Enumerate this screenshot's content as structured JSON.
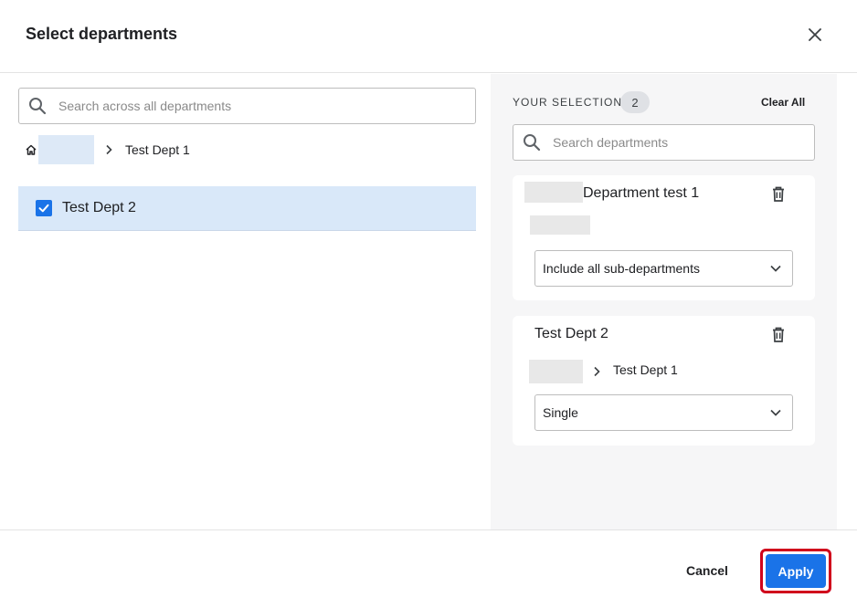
{
  "dialog": {
    "title": "Select departments"
  },
  "left": {
    "search_placeholder": "Search across all departments",
    "breadcrumb_current": "Test Dept 1",
    "items": [
      {
        "label": "Test Dept 2",
        "checked": true
      }
    ]
  },
  "right": {
    "selection_label": "YOUR SELECTION",
    "selection_count": "2",
    "clear_all": "Clear All",
    "search_placeholder": "Search departments",
    "cards": [
      {
        "title": "Department test 1",
        "path": "",
        "option": "Include all sub-departments"
      },
      {
        "title": "Test Dept 2",
        "path": "Test Dept 1",
        "option": "Single"
      }
    ]
  },
  "footer": {
    "cancel": "Cancel",
    "apply": "Apply"
  },
  "colors": {
    "accent": "#1a73e8",
    "selected_row": "#d9e8f9",
    "panel_bg": "#f6f6f7",
    "highlight_outline": "#d0021b"
  },
  "icons": {
    "close": "close-icon",
    "search": "search-icon",
    "home": "home-icon",
    "chevron": "chevron-right-icon",
    "trash": "trash-icon",
    "caret": "chevron-down-icon",
    "check": "check-icon"
  }
}
